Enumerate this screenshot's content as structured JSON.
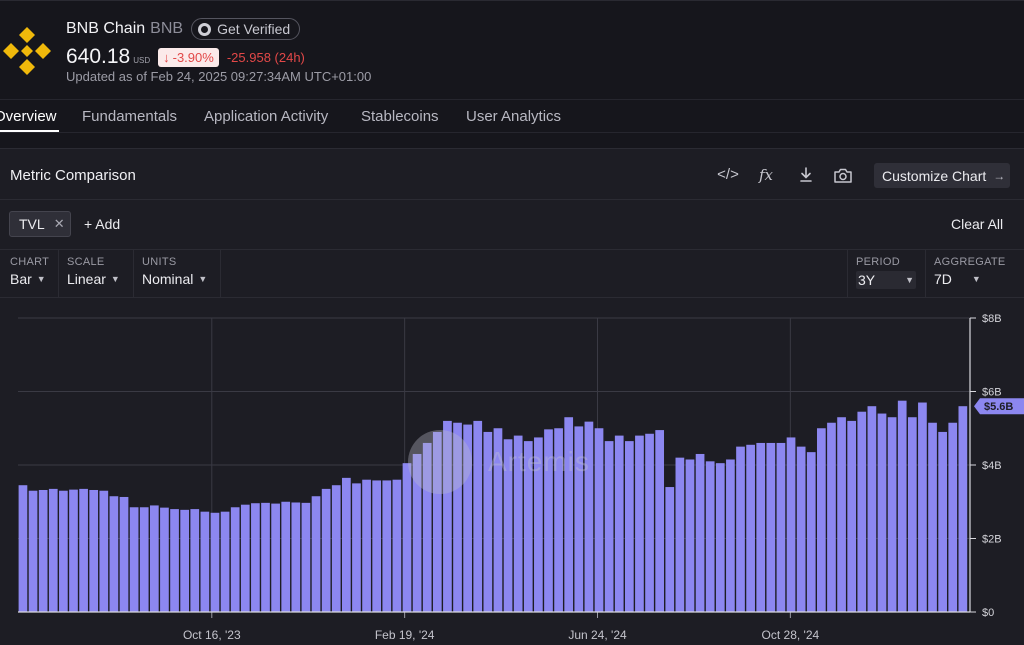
{
  "header": {
    "asset_name": "BNB Chain",
    "ticker": "BNB",
    "verify_label": "Get Verified",
    "price": "640.18",
    "currency": "USD",
    "change_pct": "-3.90%",
    "change_abs": "-25.958 (24h)",
    "updated": "Updated as of Feb 24, 2025 09:27:34AM UTC+01:00",
    "logo_icon": "bnb-logo-icon",
    "logo_color": "#f0b90b"
  },
  "tabs": [
    {
      "label": "Overview",
      "active": true
    },
    {
      "label": "Fundamentals"
    },
    {
      "label": "Application Activity"
    },
    {
      "label": "Stablecoins"
    },
    {
      "label": "User Analytics"
    }
  ],
  "panel": {
    "title": "Metric Comparison",
    "tools": [
      "code-icon",
      "function-icon",
      "download-icon",
      "camera-icon"
    ],
    "customize_label": "Customize Chart",
    "chip_label": "TVL",
    "add_label": "+ Add",
    "clear_label": "Clear All",
    "controls": {
      "chart": {
        "label": "CHART",
        "value": "Bar"
      },
      "scale": {
        "label": "SCALE",
        "value": "Linear"
      },
      "units": {
        "label": "UNITS",
        "value": "Nominal"
      },
      "period": {
        "label": "PERIOD",
        "value": "3Y"
      },
      "aggregate": {
        "label": "AGGREGATE",
        "value": "7D"
      }
    }
  },
  "watermark": "Artemis",
  "chart_data": {
    "type": "bar",
    "series": [
      {
        "name": "TVL",
        "color": "#8c87f0"
      }
    ],
    "y_unit": "USD",
    "ylim": [
      0,
      8
    ],
    "y_ticks": [
      "$0",
      "$2B",
      "$4B",
      "$6B",
      "$8B"
    ],
    "x_ticks": [
      "Oct 16, '23",
      "Feb 19, '24",
      "Jun 24, '24",
      "Oct 28, '24"
    ],
    "last_value_label": "$5.6B",
    "grid": true,
    "values_billions": [
      3.45,
      3.3,
      3.32,
      3.35,
      3.3,
      3.33,
      3.35,
      3.32,
      3.3,
      3.15,
      3.13,
      2.85,
      2.85,
      2.9,
      2.84,
      2.8,
      2.78,
      2.8,
      2.73,
      2.7,
      2.73,
      2.85,
      2.92,
      2.96,
      2.97,
      2.95,
      3.0,
      2.98,
      2.97,
      3.15,
      3.35,
      3.45,
      3.65,
      3.5,
      3.6,
      3.58,
      3.58,
      3.6,
      4.05,
      4.3,
      4.6,
      4.9,
      5.2,
      5.15,
      5.1,
      5.2,
      4.9,
      5.0,
      4.7,
      4.8,
      4.65,
      4.75,
      4.97,
      5.0,
      5.3,
      5.05,
      5.18,
      5.0,
      4.65,
      4.8,
      4.65,
      4.8,
      4.85,
      4.95,
      3.4,
      4.2,
      4.15,
      4.3,
      4.1,
      4.05,
      4.15,
      4.5,
      4.55,
      4.6,
      4.6,
      4.6,
      4.75,
      4.5,
      4.35,
      5.0,
      5.15,
      5.3,
      5.2,
      5.45,
      5.6,
      5.4,
      5.3,
      5.75,
      5.3,
      5.7,
      5.15,
      4.9,
      5.15,
      5.6
    ]
  }
}
